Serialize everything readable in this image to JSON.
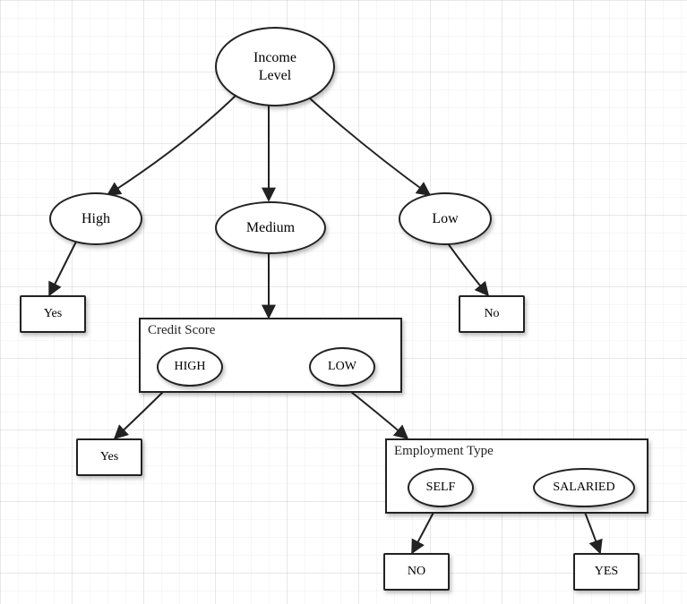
{
  "root": {
    "label": "Income\nLevel"
  },
  "income": {
    "high": {
      "label": "High",
      "outcome": "Yes"
    },
    "medium": {
      "label": "Medium"
    },
    "low": {
      "label": "Low",
      "outcome": "No"
    }
  },
  "credit": {
    "panel_title": "Credit Score",
    "high": {
      "label": "HIGH",
      "outcome": "Yes"
    },
    "low": {
      "label": "LOW"
    }
  },
  "employment": {
    "panel_title": "Employment Type",
    "self": {
      "label": "SELF",
      "outcome": "NO"
    },
    "salaried": {
      "label": "SALARIED",
      "outcome": "YES"
    }
  }
}
